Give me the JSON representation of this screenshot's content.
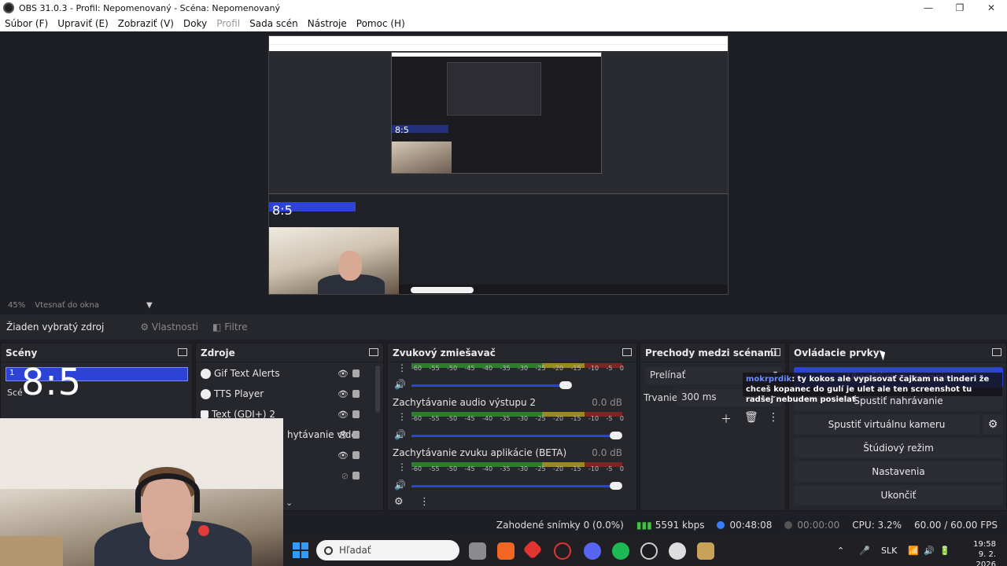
{
  "window": {
    "title": "OBS 31.0.3 - Profil: Nepomenovaný - Scéna: Nepomenovaný",
    "minimize": "—",
    "maximize": "❐",
    "close": "✕"
  },
  "menu": {
    "items": [
      {
        "label": "Súbor (F)",
        "dim": false
      },
      {
        "label": "Upraviť (E)",
        "dim": false
      },
      {
        "label": "Zobraziť (V)",
        "dim": false
      },
      {
        "label": "Doky",
        "dim": false
      },
      {
        "label": "Profil",
        "dim": true
      },
      {
        "label": "Sada scén",
        "dim": false
      },
      {
        "label": "Nástroje",
        "dim": false
      },
      {
        "label": "Pomoc (H)",
        "dim": false
      }
    ]
  },
  "preview": {
    "zoom": "45%",
    "fit_label": "Vtesnať do okna",
    "nested_clock": "8:5",
    "nested_clock_small": "8:5"
  },
  "source_toolbar": {
    "no_source": "Žiaden vybratý zdroj",
    "properties": "Vlastnosti",
    "filters": "Filtre"
  },
  "scenes": {
    "title": "Scény",
    "selected_number": "1",
    "clock_overlay": "8:5",
    "second_scene": "Scé"
  },
  "sources": {
    "title": "Zdroje",
    "items": [
      {
        "label": "Gif Text Alerts",
        "visible": true
      },
      {
        "label": "TTS Player",
        "visible": true
      },
      {
        "label": "Text (GDI+) 2",
        "visible": true
      },
      {
        "label": "hytávanie vide",
        "visible": true
      },
      {
        "label": "",
        "visible": true
      },
      {
        "label": "",
        "visible": false
      }
    ]
  },
  "mixer": {
    "title": "Zvukový zmiešavač",
    "scale": [
      "-60",
      "-55",
      "-50",
      "-45",
      "-40",
      "-35",
      "-30",
      "-25",
      "-20",
      "-15",
      "-10",
      "-5",
      "0"
    ],
    "channels": [
      {
        "name": "",
        "db": ""
      },
      {
        "name": "Zachytávanie audio výstupu 2",
        "db": "0.0 dB"
      },
      {
        "name": "Zachytávanie zvuku aplikácie (BETA)",
        "db": "0.0 dB"
      }
    ]
  },
  "transitions": {
    "title": "Prechody medzi scénami",
    "selected": "Prelínať",
    "duration_label": "Trvanie",
    "duration_value": "300 ms"
  },
  "controls": {
    "title": "Ovládacie prvky",
    "start_stream": "Ukončiť streamovanie",
    "start_record": "Spustiť nahrávanie",
    "virtual_cam": "Spustiť virtuálnu kameru",
    "studio_mode": "Štúdiový režim",
    "settings": "Nastavenia",
    "exit": "Ukončiť"
  },
  "chat": {
    "user": "mokrprdik",
    "message": ": ty kokos ale vypisovať čajkam na tinderi že chceš kopanec do gulí je ulet ale ten screenshot tu radšej nebudem posielať"
  },
  "status": {
    "dropped": "Zahodené snímky 0 (0.0%)",
    "bitrate": "5591 kbps",
    "stream_time": "00:48:08",
    "rec_time": "00:00:00",
    "cpu": "CPU: 3.2%",
    "fps": "60.00 / 60.00 FPS"
  },
  "taskbar": {
    "search_placeholder": "Hľadať",
    "lang": "SLK",
    "time": "19:58",
    "date": "9. 2. 2026"
  }
}
